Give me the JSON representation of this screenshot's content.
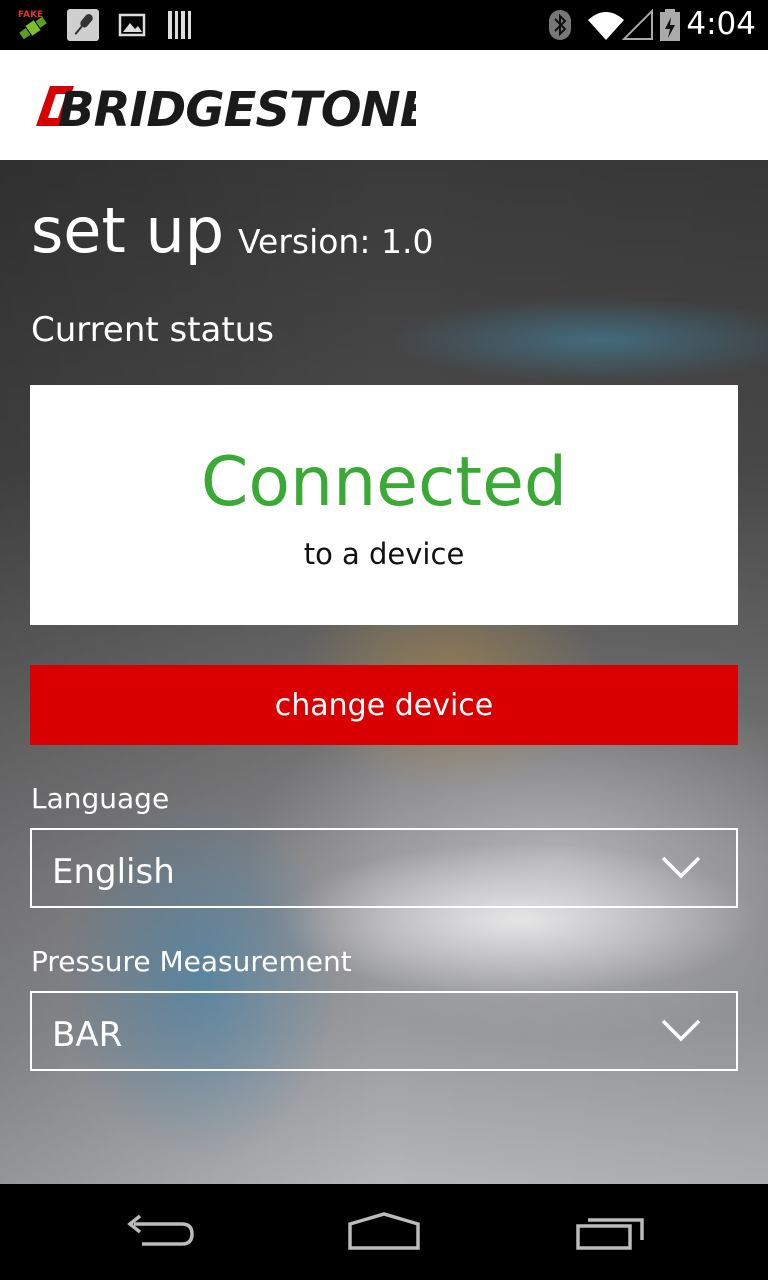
{
  "status_bar": {
    "time": "4:04",
    "icons": [
      "fake-gps-icon",
      "microphone-icon",
      "image-icon",
      "barcode-icon",
      "bluetooth-icon",
      "wifi-icon",
      "signal-icon",
      "battery-icon"
    ]
  },
  "header": {
    "brand": "BRIDGESTONE"
  },
  "main": {
    "title": "set up",
    "version": "Version: 1.0",
    "current_status_label": "Current status",
    "status": {
      "main": "Connected",
      "sub": "to a device"
    },
    "change_device_label": "change device",
    "language": {
      "label": "Language",
      "value": "English"
    },
    "pressure": {
      "label": "Pressure Measurement",
      "value": "BAR"
    }
  },
  "colors": {
    "accent_red": "#d80000",
    "status_green": "#3aa935"
  },
  "nav": {
    "icons": [
      "back-icon",
      "home-icon",
      "recents-icon"
    ]
  }
}
